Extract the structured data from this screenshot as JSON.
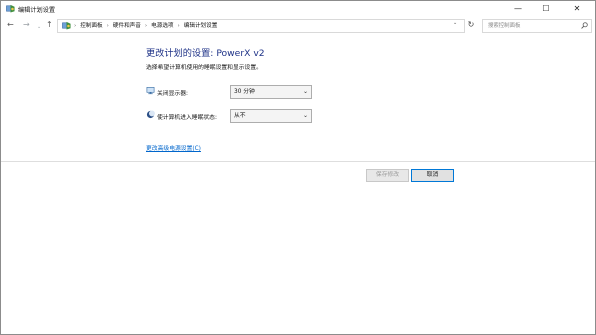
{
  "window": {
    "title": "编辑计划设置",
    "controls": {
      "minimize": "—",
      "maximize": "☐",
      "close": "✕"
    }
  },
  "nav": {
    "back": "←",
    "forward": "→",
    "dropdown": "⌄",
    "up": "↑",
    "breadcrumbs": [
      "控制面板",
      "硬件和声音",
      "电源选项",
      "编辑计划设置"
    ],
    "separator": "›",
    "address_dropdown": "⌄",
    "refresh": "↻"
  },
  "search": {
    "placeholder": "搜索控制面板",
    "icon": "search-icon"
  },
  "main": {
    "heading": "更改计划的设置: PowerX v2",
    "subheading": "选择希望计算机使用的睡眠设置和显示设置。",
    "settings": [
      {
        "label": "关闭显示器:",
        "value": "30 分钟",
        "icon": "monitor-icon"
      },
      {
        "label": "使计算机进入睡眠状态:",
        "value": "从不",
        "icon": "moon-icon"
      }
    ],
    "advanced_link": "更改高级电源设置(C)"
  },
  "footer": {
    "save_label": "保存修改",
    "cancel_label": "取消"
  },
  "colors": {
    "heading": "#1e3287",
    "link": "#0066cc",
    "focus_border": "#0078d7"
  }
}
